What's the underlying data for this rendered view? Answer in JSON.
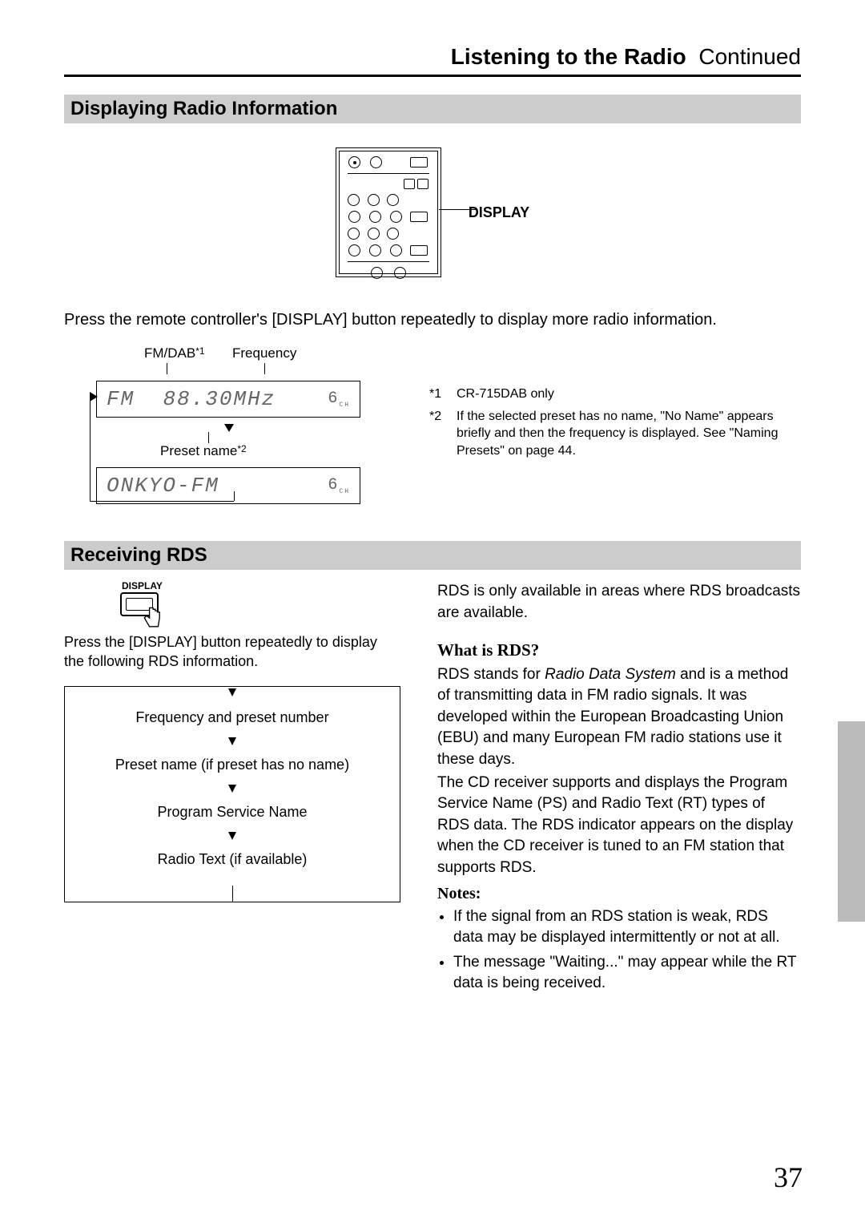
{
  "header": {
    "bold": "Listening to the Radio",
    "thin": "Continued"
  },
  "section1": {
    "title": "Displaying Radio Information",
    "display_label": "DISPLAY",
    "body": "Press the remote controller's [DISPLAY] button repeatedly to display more radio information.",
    "lbl_fmdab": "FM/DAB",
    "lbl_fmdab_sup": "*1",
    "lbl_freq": "Frequency",
    "lcd1_left": "FM",
    "lcd1_right": "88.30MHz",
    "lcd1_ch": "6",
    "preset_name_label": "Preset name",
    "preset_name_sup": "*2",
    "lcd2_left": "ONKYO-FM",
    "lcd2_ch": "6",
    "footnotes": [
      {
        "num": "*1",
        "text": "CR-715DAB only"
      },
      {
        "num": "*2",
        "text": "If the selected preset has no name, \"No Name\" appears briefly and then the frequency is displayed. See \"Naming Presets\" on page 44."
      }
    ]
  },
  "section2": {
    "title": "Receiving RDS",
    "disp_icon_label": "DISPLAY",
    "left_intro": "Press the [DISPLAY] button repeatedly to display the following RDS information.",
    "flow": [
      "Frequency and preset number",
      "Preset name (if preset has no name)",
      "Program Service Name",
      "Radio Text (if available)"
    ],
    "right_intro": "RDS is only available in areas where RDS broadcasts are available.",
    "whatis_head": "What is RDS?",
    "whatis_body_1": "RDS stands for ",
    "whatis_em": "Radio Data System",
    "whatis_body_2": " and is a method of transmitting data in FM radio signals. It was developed within the European Broadcasting Union (EBU) and many European FM radio stations use it these days.",
    "whatis_body_3": "The CD receiver supports and displays the Program Service Name (PS) and Radio Text (RT) types of RDS data. The RDS indicator appears on the display when the CD receiver is tuned to an FM station that supports RDS.",
    "notes_head": "Notes:",
    "notes": [
      "If the signal from an RDS station is weak, RDS data may be displayed intermittently or not at all.",
      "The message \"Waiting...\" may appear while the RT data is being received."
    ]
  },
  "page_number": "37"
}
